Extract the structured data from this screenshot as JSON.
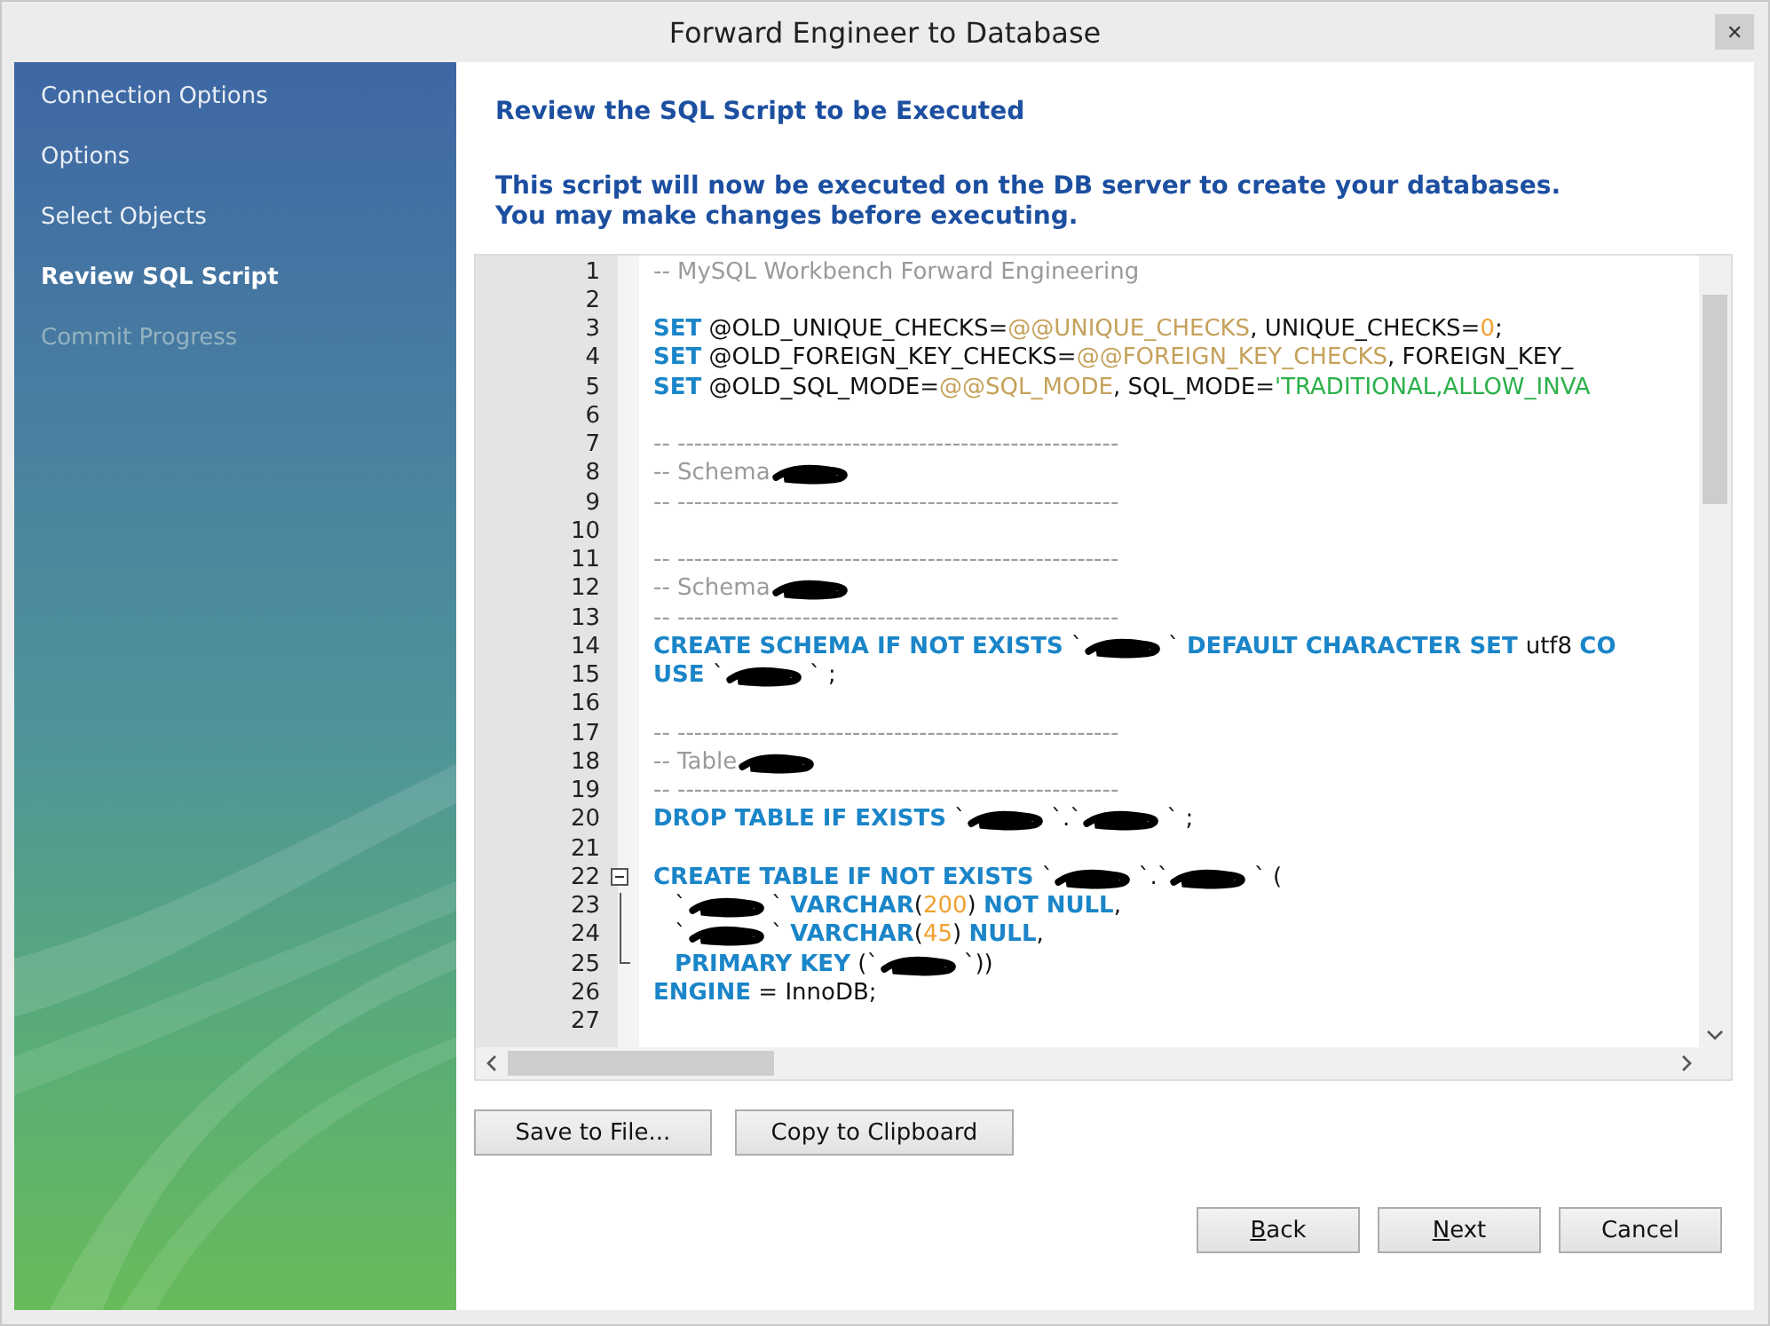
{
  "window": {
    "title": "Forward Engineer to Database",
    "close": "✕"
  },
  "sidebar": {
    "items": [
      {
        "label": "Connection Options",
        "selected": false,
        "disabled": false
      },
      {
        "label": "Options",
        "selected": false,
        "disabled": false
      },
      {
        "label": "Select Objects",
        "selected": false,
        "disabled": false
      },
      {
        "label": "Review SQL Script",
        "selected": true,
        "disabled": false
      },
      {
        "label": "Commit Progress",
        "selected": false,
        "disabled": true
      }
    ]
  },
  "heading": "Review the SQL Script to be Executed",
  "description": [
    "This script will now be executed on the DB server to create your databases.",
    "You may make changes before executing."
  ],
  "editor": {
    "lines": [
      {
        "number": "1",
        "tokens": [
          {
            "kind": "comment",
            "text": "-- MySQL Workbench Forward Engineering"
          }
        ]
      },
      {
        "number": "2"
      },
      {
        "number": "3",
        "tokens": [
          {
            "kind": "kw",
            "text": "SET"
          },
          {
            "kind": "plain",
            "text": " @OLD_UNIQUE_CHECKS="
          },
          {
            "kind": "var",
            "text": "@@UNIQUE_CHECKS"
          },
          {
            "kind": "plain",
            "text": ", UNIQUE_CHECKS="
          },
          {
            "kind": "num",
            "text": "0"
          },
          {
            "kind": "plain",
            "text": ";"
          }
        ]
      },
      {
        "number": "4",
        "tokens": [
          {
            "kind": "kw",
            "text": "SET"
          },
          {
            "kind": "plain",
            "text": " @OLD_FOREIGN_KEY_CHECKS="
          },
          {
            "kind": "var",
            "text": "@@FOREIGN_KEY_CHECKS"
          },
          {
            "kind": "plain",
            "text": ", FOREIGN_KEY_"
          }
        ]
      },
      {
        "number": "5",
        "tokens": [
          {
            "kind": "kw",
            "text": "SET"
          },
          {
            "kind": "plain",
            "text": " @OLD_SQL_MODE="
          },
          {
            "kind": "var",
            "text": "@@SQL_MODE"
          },
          {
            "kind": "plain",
            "text": ", SQL_MODE="
          },
          {
            "kind": "str",
            "text": "'TRADITIONAL,ALLOW_INVA"
          }
        ]
      },
      {
        "number": "6"
      },
      {
        "number": "7",
        "tokens": [
          {
            "kind": "comment",
            "text": "-- -----------------------------------------------------"
          }
        ]
      },
      {
        "number": "8",
        "tokens": [
          {
            "kind": "comment",
            "text": "-- Schema"
          },
          {
            "kind": "redacted"
          }
        ]
      },
      {
        "number": "9",
        "tokens": [
          {
            "kind": "comment",
            "text": "-- -----------------------------------------------------"
          }
        ]
      },
      {
        "number": "10"
      },
      {
        "number": "11",
        "tokens": [
          {
            "kind": "comment",
            "text": "-- -----------------------------------------------------"
          }
        ]
      },
      {
        "number": "12",
        "tokens": [
          {
            "kind": "comment",
            "text": "-- Schema"
          },
          {
            "kind": "redacted"
          }
        ]
      },
      {
        "number": "13",
        "tokens": [
          {
            "kind": "comment",
            "text": "-- -----------------------------------------------------"
          }
        ]
      },
      {
        "number": "14",
        "tokens": [
          {
            "kind": "kw",
            "text": "CREATE SCHEMA IF NOT EXISTS "
          },
          {
            "kind": "plain",
            "text": "`"
          },
          {
            "kind": "redacted"
          },
          {
            "kind": "plain",
            "text": "` "
          },
          {
            "kind": "kw",
            "text": "DEFAULT CHARACTER SET "
          },
          {
            "kind": "plain",
            "text": "utf8 "
          },
          {
            "kind": "kw",
            "text": "CO"
          }
        ]
      },
      {
        "number": "15",
        "tokens": [
          {
            "kind": "kw",
            "text": "USE "
          },
          {
            "kind": "plain",
            "text": "`"
          },
          {
            "kind": "redacted"
          },
          {
            "kind": "plain",
            "text": "` ;"
          }
        ]
      },
      {
        "number": "16"
      },
      {
        "number": "17",
        "tokens": [
          {
            "kind": "comment",
            "text": "-- -----------------------------------------------------"
          }
        ]
      },
      {
        "number": "18",
        "tokens": [
          {
            "kind": "comment",
            "text": "-- Table"
          },
          {
            "kind": "redacted"
          }
        ]
      },
      {
        "number": "19",
        "tokens": [
          {
            "kind": "comment",
            "text": "-- -----------------------------------------------------"
          }
        ]
      },
      {
        "number": "20",
        "tokens": [
          {
            "kind": "kw",
            "text": "DROP TABLE IF EXISTS "
          },
          {
            "kind": "plain",
            "text": "`"
          },
          {
            "kind": "redacted"
          },
          {
            "kind": "plain",
            "text": "`.`"
          },
          {
            "kind": "redacted"
          },
          {
            "kind": "plain",
            "text": "` ;"
          }
        ]
      },
      {
        "number": "21"
      },
      {
        "number": "22",
        "kind": "fold-start",
        "tokens": [
          {
            "kind": "kw",
            "text": "CREATE TABLE IF NOT EXISTS "
          },
          {
            "kind": "plain",
            "text": "`"
          },
          {
            "kind": "redacted"
          },
          {
            "kind": "plain",
            "text": "`.`"
          },
          {
            "kind": "redacted"
          },
          {
            "kind": "plain",
            "text": "` ("
          }
        ]
      },
      {
        "number": "23",
        "kind": "fold-mid",
        "indent": true,
        "tokens": [
          {
            "kind": "plain",
            "text": "`"
          },
          {
            "kind": "redacted"
          },
          {
            "kind": "plain",
            "text": "` "
          },
          {
            "kind": "kw",
            "text": "VARCHAR"
          },
          {
            "kind": "plain",
            "text": "("
          },
          {
            "kind": "num",
            "text": "200"
          },
          {
            "kind": "plain",
            "text": ") "
          },
          {
            "kind": "kw",
            "text": "NOT NULL"
          },
          {
            "kind": "plain",
            "text": ","
          }
        ]
      },
      {
        "number": "24",
        "kind": "fold-mid",
        "indent": true,
        "tokens": [
          {
            "kind": "plain",
            "text": "`"
          },
          {
            "kind": "redacted"
          },
          {
            "kind": "plain",
            "text": "` "
          },
          {
            "kind": "kw",
            "text": "VARCHAR"
          },
          {
            "kind": "plain",
            "text": "("
          },
          {
            "kind": "num",
            "text": "45"
          },
          {
            "kind": "plain",
            "text": ") "
          },
          {
            "kind": "kw",
            "text": "NULL"
          },
          {
            "kind": "plain",
            "text": ","
          }
        ]
      },
      {
        "number": "25",
        "kind": "fold-end",
        "indent": true,
        "tokens": [
          {
            "kind": "kw",
            "text": "PRIMARY KEY"
          },
          {
            "kind": "plain",
            "text": " (`"
          },
          {
            "kind": "redacted"
          },
          {
            "kind": "plain",
            "text": "`))"
          }
        ]
      },
      {
        "number": "26",
        "tokens": [
          {
            "kind": "kw",
            "text": "ENGINE"
          },
          {
            "kind": "plain",
            "text": " = InnoDB;"
          }
        ]
      },
      {
        "number": "27"
      }
    ]
  },
  "file_buttons": [
    {
      "label": "Save to File..."
    },
    {
      "label": "Copy to Clipboard"
    }
  ],
  "nav_buttons": [
    {
      "key": "B",
      "rest": "ack"
    },
    {
      "key": "N",
      "rest": "ext"
    },
    {
      "rest": "Cancel"
    }
  ]
}
